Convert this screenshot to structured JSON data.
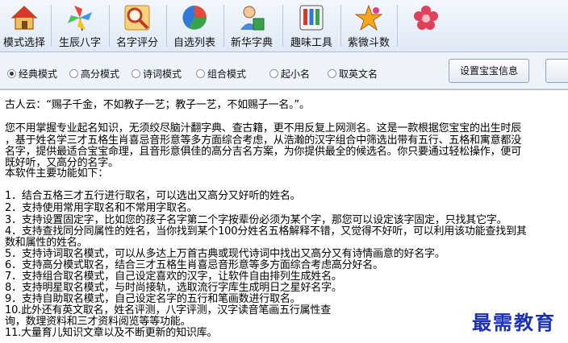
{
  "toolbar": {
    "items": [
      {
        "label": "模式选择",
        "icon": "house-icon"
      },
      {
        "label": "生辰八字",
        "icon": "pinwheel-icon"
      },
      {
        "label": "名字评分",
        "icon": "magnifier-icon"
      },
      {
        "label": "自选列表",
        "icon": "pie-chart-icon"
      },
      {
        "label": "新华字典",
        "icon": "person-book-icon"
      },
      {
        "label": "趣味工具",
        "icon": "toolbox-icon"
      },
      {
        "label": "紫微斗数",
        "icon": "star-icon"
      },
      {
        "label": "",
        "icon": "flower-icon"
      }
    ]
  },
  "modes": {
    "options": [
      "经典模式",
      "高分模式",
      "诗词模式",
      "组合模式",
      "起小名",
      "取英文名"
    ],
    "selected": "经典模式",
    "set_baby_info_label": "设置宝宝信息"
  },
  "content": {
    "lines": [
      "古人云：“赐子千金，不如教子一艺；教子一艺，不如赐子一名。”。",
      "您不用掌握专业起名知识，无须绞尽脑汁翻字典、查古籍，更不用反复上网测名。这是一款根据您宝宝的出生时辰",
      "，基于姓名学三才五格生肖喜忌音形意等多方面综合考虑，从浩瀚的汉字组合中筛选出带有五行、五格和寓意都没",
      "名字，提供最适合宝宝命理，且音形意俱佳的高分吉名方案，为你提供最全的候选名。你只要通过轻松操作，便可",
      "既好听，又高分的名字。",
      "本软件主要功能如下：",
      "1．结合五格三才五行进行取名，可以选出又高分又好听的姓名。",
      "2．支持使用常用字取名和不常用字取名。",
      "3．支持设置固定字，比如您的孩子名字第二个字按辈份必须为某个字，那您可以设定该字固定，只找其它字。",
      "4．支持查找同分同属性的姓名，当你找到某个100分姓名五格解释不错，又觉得不好听，可以利用该功能查找到其",
      "数和属性的姓名。",
      "5．支持诗词取名模式，可以从多达上万首古典或现代诗词中找出又高分又有诗情画意的好名字。",
      "6．支持高分模式取名，结合三才五格生肖喜忌音形意等多方面综合考虑高分好名。",
      "7．支持组合取名模式，自己设定喜欢的汉字，让软件自由排列生成姓名。",
      "8．支持明星取名模式，与时尚接轨，选取流行字库生成明日之星好名字。",
      "9．支持自助取名模式，自己设定名字的五行和笔画数进行取名。",
      "10.此外还有英文取名，姓名评测，八字评测，汉字读音笔画五行属性查",
      "询，数理资料和三才资料阅览等等功能。",
      "11.大量育儿知识文章以及不断更新的知识库。"
    ]
  },
  "watermark": "最需教育",
  "colors": {
    "toolbar_bg": "#e6eef8",
    "watermark": "#1a2fb8"
  }
}
